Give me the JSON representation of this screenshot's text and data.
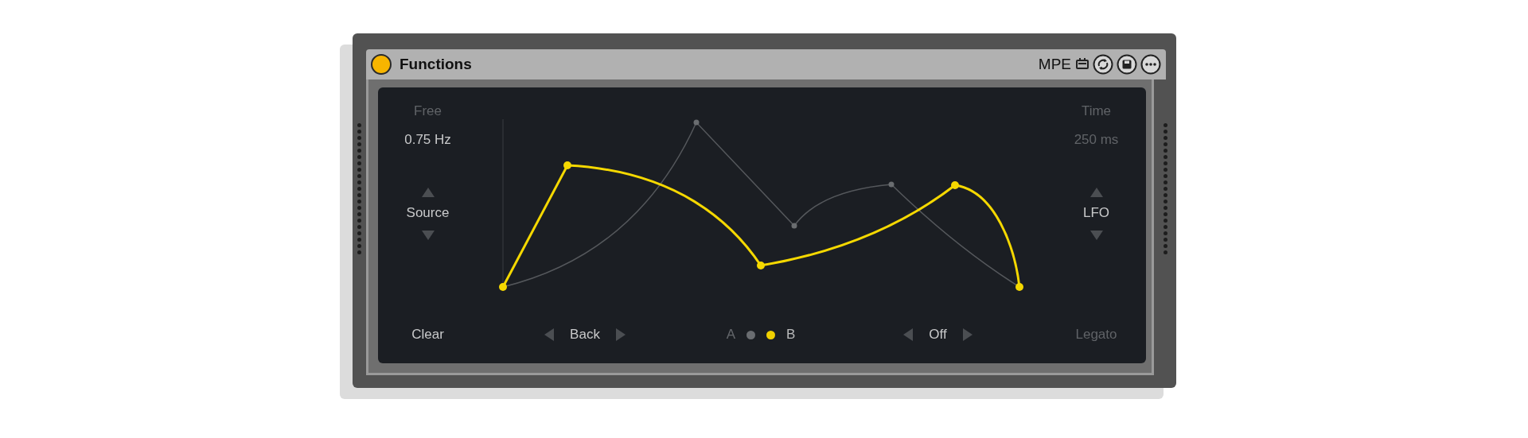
{
  "device": {
    "title": "Functions",
    "on": true,
    "mpe_label": "MPE"
  },
  "left": {
    "mode": "Free",
    "rate": "0.75 Hz",
    "selector": "Source"
  },
  "right": {
    "label": "Time",
    "value": "250 ms",
    "enabled": false,
    "selector": "LFO"
  },
  "bottom": {
    "clear": "Clear",
    "direction": "Back",
    "slots": [
      {
        "label": "A",
        "selected": false
      },
      {
        "label": "B",
        "selected": true
      }
    ],
    "hold": "Off",
    "legato": {
      "label": "Legato",
      "on": false
    }
  }
}
